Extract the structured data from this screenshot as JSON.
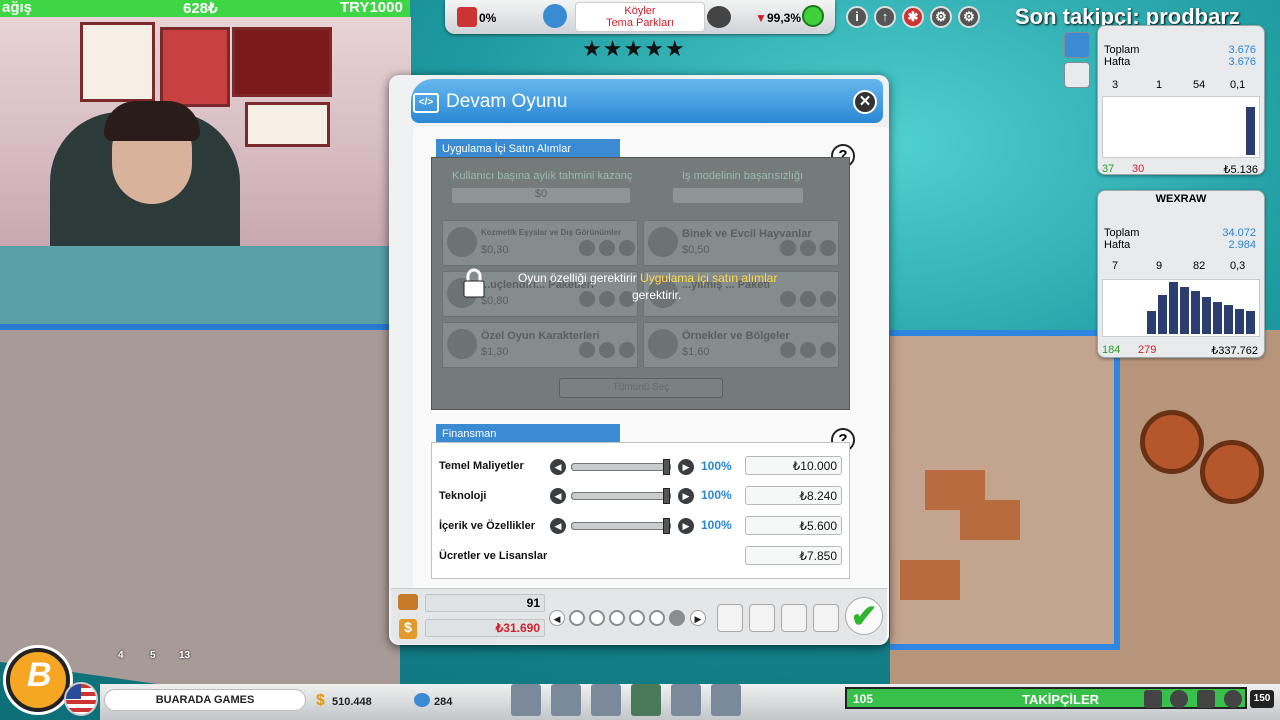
{
  "stream": {
    "donation_label": "ağış",
    "donation_amount": "628₺",
    "donation_goal": "TRY1000",
    "ticker": "Son takipçi: prodbarz"
  },
  "hud": {
    "quality_pct": "0%",
    "game_topic": "Köyler",
    "game_genre": "Tema Parkları",
    "rating_pct": "99,3%",
    "rating_stars": "★★★★★"
  },
  "panels": [
    {
      "name": "",
      "total_label": "Toplam",
      "week_label": "Hafta",
      "total": "3.676",
      "week": "3.676",
      "stat_a": "3",
      "stat_b": "1",
      "stat_c": "54",
      "stat_d": "0,1",
      "up": "37",
      "down": "30",
      "money": "₺5.136",
      "bars": [
        0,
        0,
        0,
        0,
        0,
        0,
        0,
        0,
        0,
        0,
        0,
        0,
        0,
        0.85
      ]
    },
    {
      "name": "WEXRAW",
      "total_label": "Toplam",
      "week_label": "Hafta",
      "total": "34.072",
      "week": "2.984",
      "stat_a": "7",
      "stat_b": "9",
      "stat_c": "82",
      "stat_d": "0,3",
      "up": "184",
      "down": "279",
      "money": "₺337.762",
      "bars": [
        0.45,
        0.75,
        1.0,
        0.9,
        0.82,
        0.72,
        0.62,
        0.55,
        0.48,
        0.45
      ]
    }
  ],
  "dialog": {
    "title": "Devam Oyunu",
    "iap_section": "Uygulama İçi Satın Alımlar",
    "iap_est_label": "Kullanıcı başına aylık tahmini kazanç",
    "iap_est_value": "$0",
    "iap_success_label": "İş modelinin başarısızlığı",
    "iap_items": [
      {
        "name": "Kozmetik Eşyalar ve Dış Görünümler",
        "price": "$0,30"
      },
      {
        "name": "Binek ve Evcil Hayvanlar",
        "price": "$0,50"
      },
      {
        "name": "...uçlendiri... Paketleri",
        "price": "$0,80"
      },
      {
        "name": "...yılmış ... Paketi",
        "price": ""
      },
      {
        "name": "Özel Oyun Karakterleri",
        "price": "$1,30"
      },
      {
        "name": "Örnekler ve Bölgeler",
        "price": "$1,60"
      }
    ],
    "locked_msg_a": "Oyun özelliği gerektirir",
    "locked_msg_link": "Uygulama içi satın alımlar",
    "locked_msg_b": "gerektirir.",
    "select_all": "Tümünü Seç",
    "finance_section": "Finansman",
    "finance_rows": [
      {
        "label": "Temel Maliyetler",
        "pct": "100%",
        "value": "₺10.000",
        "level": 1.0
      },
      {
        "label": "Teknoloji",
        "pct": "100%",
        "value": "₺8.240",
        "level": 1.0
      },
      {
        "label": "İçerik ve Özellikler",
        "pct": "100%",
        "value": "₺5.600",
        "level": 1.0
      }
    ],
    "fees_label": "Ücretler ve Lisanslar",
    "fees_value": "₺7.850",
    "footer_count": "91",
    "footer_cost": "₺31.690"
  },
  "bottom": {
    "company": "BUARADA GAMES",
    "money": "510.448",
    "employees": "284",
    "fans_count": "105",
    "fans_label": "TAKİPÇİLER",
    "speed": "150",
    "icon_counts": [
      "4",
      "5",
      "13"
    ]
  },
  "colors": {
    "accent": "#2b88d4",
    "green": "#38c14a",
    "down": "#d0202a"
  }
}
